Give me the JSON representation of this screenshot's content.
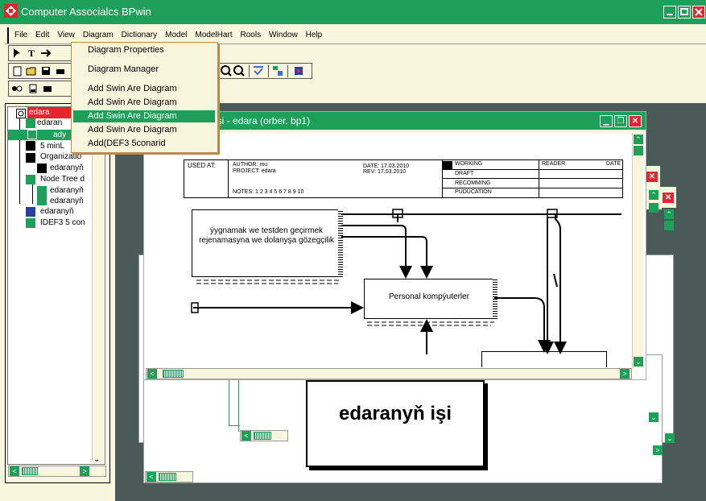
{
  "app": {
    "title": "Computer Associalcs BPwin"
  },
  "menu": [
    "File",
    "Edit",
    "View",
    "Diagram",
    "Dictionary",
    "Model",
    "ModelHart",
    "Rools",
    "Window",
    "Help"
  ],
  "dropdown": [
    "Diagram Properties",
    "Diagram Manager",
    "Add Swin Are Diagram",
    "Add Swin Are Diagram",
    "Add Swin Are Diagram",
    "Add Swin Are Diagram",
    "Add(DEF3 5conarid"
  ],
  "tree": {
    "items": [
      "edara",
      "edaran",
      "ady",
      "5 minL",
      "Organizatio",
      "edaranyň",
      "Node Tree d",
      "edaranyň",
      "edaranyň",
      "edaranyň",
      "IDEF3 5 con"
    ]
  },
  "diagram_window": {
    "title": "ň işi - edara  (orber. bp1)"
  },
  "frame": {
    "used_at": "USED AT:",
    "author": "AUTHOR:  mu",
    "project": "PROJECT:  edara",
    "date": "DATE:  17.03.2010",
    "rev": "REV:  17.03.2010",
    "notes": "NOTES:  1 2 3 4 5 6 7 8 9 10",
    "working": "WORKING",
    "draft": "DRAFT",
    "recomming": "RECOMMING",
    "pudu": "PUDUCATION",
    "reader": "READER",
    "date2": "DATE"
  },
  "boxes": {
    "box1": "ýygnamak we testden geçirmek rejenamasyna we dolanyşa gözegçilik",
    "box2": "Personal kompýuterler"
  },
  "bottom_title": "edaranyň  işi",
  "colors": {
    "green": "#1fa05a",
    "red": "#e5252a",
    "cream": "#f8f6dd",
    "dark": "#4a5a57"
  }
}
